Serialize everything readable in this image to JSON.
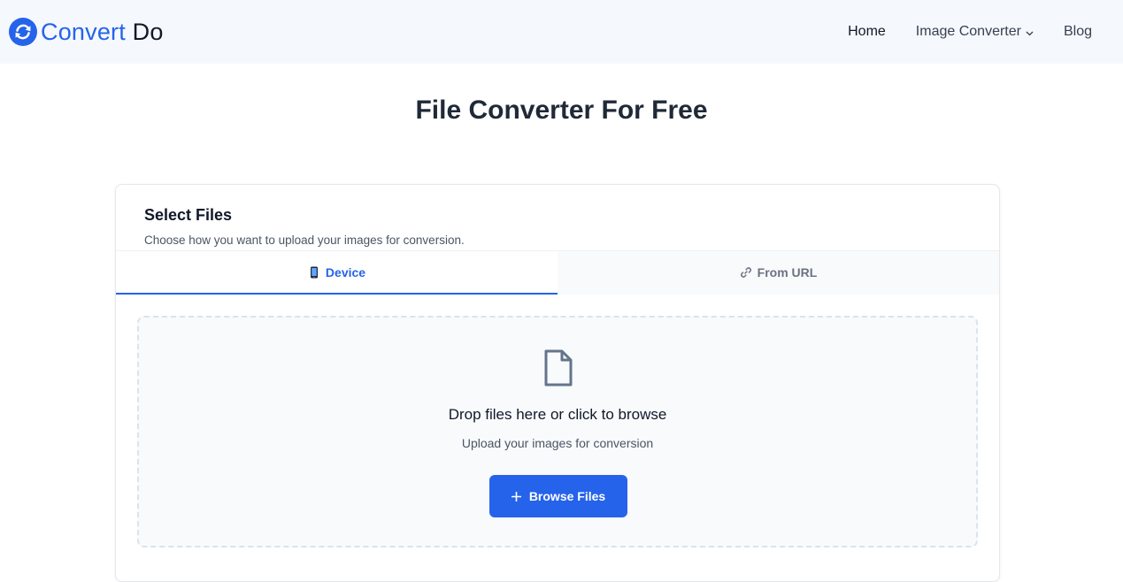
{
  "brand": {
    "name_part1": "Convert",
    "name_part2": "Do",
    "logo_icon": "sync-circle-icon"
  },
  "nav": {
    "home": "Home",
    "image_converter": "Image Converter",
    "blog": "Blog"
  },
  "page": {
    "title": "File Converter For Free"
  },
  "card": {
    "title": "Select Files",
    "subtitle": "Choose how you want to upload your images for conversion."
  },
  "tabs": [
    {
      "label": "Device",
      "icon": "mobile-phone-icon",
      "active": true
    },
    {
      "label": "From URL",
      "icon": "link-icon",
      "active": false
    }
  ],
  "dropzone": {
    "icon": "file-icon",
    "title": "Drop files here or click to browse",
    "subtitle": "Upload your images for conversion",
    "button_label": "Browse Files",
    "button_icon": "plus-icon"
  },
  "colors": {
    "accent": "#2563eb",
    "navbar_bg": "#f5f8fc",
    "text_dark": "#1f2937"
  }
}
